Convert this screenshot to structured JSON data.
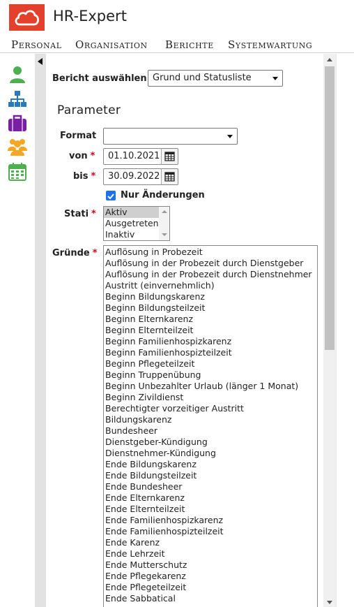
{
  "app": {
    "title": "HR-Expert",
    "brand_color": "#e4412d"
  },
  "menu": [
    "Personal",
    "Organisation",
    "Berichte",
    "Systemwartung"
  ],
  "sidebar_icons": [
    {
      "name": "person-icon",
      "color": "#4caf50"
    },
    {
      "name": "org-chart-icon",
      "color": "#2a7ab8"
    },
    {
      "name": "briefcase-icon",
      "color": "#7b1fa2"
    },
    {
      "name": "group-icon",
      "color": "#f5a623"
    },
    {
      "name": "calendar-icon",
      "color": "#4caf50"
    }
  ],
  "report": {
    "label": "Bericht auswählen",
    "selected": "Grund und Statusliste"
  },
  "parameter": {
    "heading": "Parameter",
    "format_label": "Format",
    "format_value": "",
    "von_label": "von",
    "von_value": "01.10.2021",
    "bis_label": "bis",
    "bis_value": "30.09.2022",
    "required_marker": "*",
    "only_changes_label": "Nur Änderungen",
    "only_changes_checked": true,
    "stati_label": "Stati",
    "stati_options": [
      "Aktiv",
      "Ausgetreten",
      "Inaktiv"
    ],
    "stati_selected": "Aktiv",
    "gruende_label": "Gründe",
    "gruende_options": [
      "Auflösung in Probezeit",
      "Auflösung in der Probezeit durch Dienstgeber",
      "Auflösung in der Probezeit durch Dienstnehmer",
      "Austritt (einvernehmlich)",
      "Beginn Bildungskarenz",
      "Beginn Bildungsteilzeit",
      "Beginn Elternkarenz",
      "Beginn Elternteilzeit",
      "Beginn Familienhospizkarenz",
      "Beginn Familienhospizteilzeit",
      "Beginn Pflegeteilzeit",
      "Beginn Truppenübung",
      "Beginn Unbezahlter Urlaub (länger 1 Monat)",
      "Beginn Zivildienst",
      "Berechtigter vorzeitiger Austritt",
      "Bildungskarenz",
      "Bundesheer",
      "Dienstgeber-Kündigung",
      "Dienstnehmer-Kündigung",
      "Ende Bildungskarenz",
      "Ende Bildungsteilzeit",
      "Ende Bundesheer",
      "Ende Elternkarenz",
      "Ende Elternteilzeit",
      "Ende Familienhospizkarenz",
      "Ende Familienhospizteilzeit",
      "Ende Karenz",
      "Ende Lehrzeit",
      "Ende Mutterschutz",
      "Ende Pflegekarenz",
      "Ende Pflegeteilzeit",
      "Ende Sabbatical"
    ]
  }
}
